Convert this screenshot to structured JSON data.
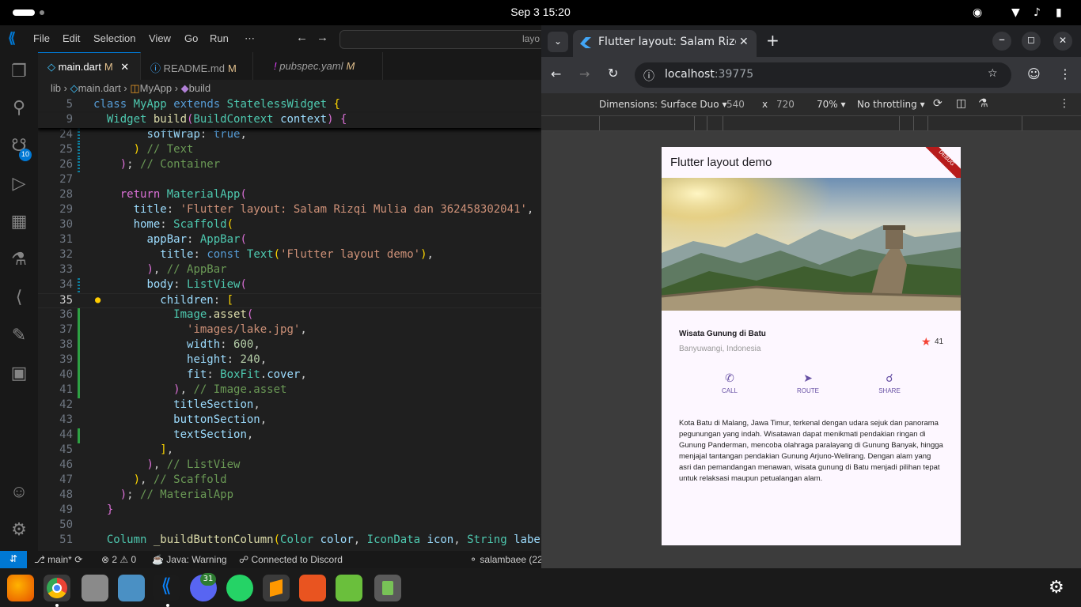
{
  "topbar": {
    "clock": "Sep 3  15:20"
  },
  "vscode": {
    "menu": [
      "File",
      "Edit",
      "Selection",
      "View",
      "Go",
      "Run",
      "⋯"
    ],
    "search_placeholder": "layo",
    "tabs": [
      {
        "label": "main.dart",
        "status": "M"
      },
      {
        "label": "README.md",
        "status": "M"
      },
      {
        "label": "pubspec.yaml",
        "status": "M"
      }
    ],
    "breadcrumb": [
      "lib",
      "main.dart",
      "MyApp",
      "build"
    ],
    "source_control_badge": "10",
    "status": {
      "branch": "main*",
      "problems": "2",
      "warnings": "0",
      "java": "Java: Warning",
      "discord": "Connected to Discord",
      "user": "salambaee (22"
    }
  },
  "chrome": {
    "tab_title": "Flutter layout: Salam Rizqi",
    "url_host": "localhost",
    "url_port": ":39775",
    "devtools": {
      "dimensions": "Dimensions: Surface Duo",
      "width": "540",
      "times": "x",
      "height": "720",
      "zoom": "70%",
      "throttling": "No throttling"
    }
  },
  "app": {
    "appbar_title": "Flutter layout demo",
    "debug_banner": "DEBUG",
    "place": "Wisata Gunung di Batu",
    "location": "Banyuwangi, Indonesia",
    "rating": "41",
    "buttons": [
      "CALL",
      "ROUTE",
      "SHARE"
    ],
    "description": "Kota Batu di Malang, Jawa Timur, terkenal dengan udara sejuk dan panorama pegunungan yang indah. Wisatawan dapat menikmati pendakian ringan di Gunung Panderman, mencoba olahraga paralayang di Gunung Banyak, hingga menjajal tantangan pendakian Gunung Arjuno-Welirang. Dengan alam yang asri dan pemandangan menawan, wisata gunung di Batu menjadi pilihan tepat untuk relaksasi maupun petualangan alam."
  },
  "dock": {
    "notification_badge": "31"
  }
}
